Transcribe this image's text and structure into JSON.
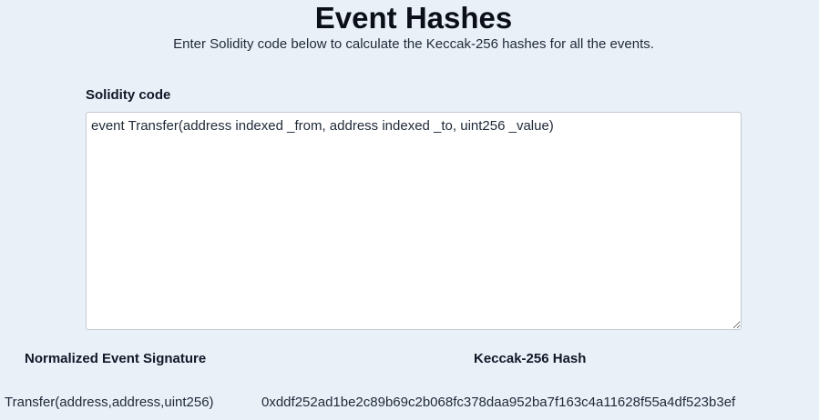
{
  "header": {
    "title": "Event Hashes",
    "subtitle": "Enter Solidity code below to calculate the Keccak-256 hashes for all the events."
  },
  "editor": {
    "label": "Solidity code",
    "value": "event Transfer(address indexed _from, address indexed _to, uint256 _value)"
  },
  "results": {
    "columns": [
      "Normalized Event Signature",
      "Keccak-256 Hash"
    ],
    "rows": [
      {
        "signature": "Transfer(address,address,uint256)",
        "hash": "0xddf252ad1be2c89b69c2b068fc378daa952ba7f163c4a11628f55a4df523b3ef"
      }
    ]
  }
}
